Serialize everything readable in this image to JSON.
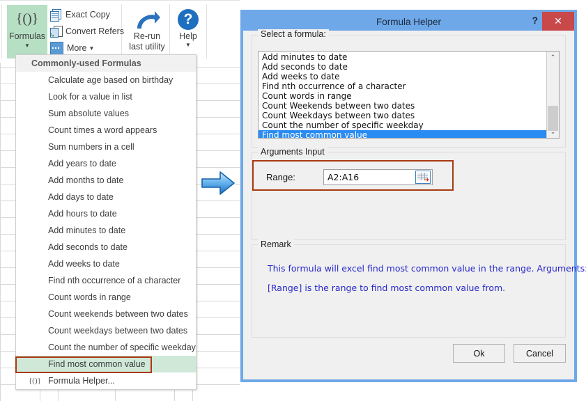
{
  "ribbon": {
    "formulas_button": {
      "glyph": "{()}",
      "label": "Formulas",
      "caret": "▼"
    },
    "items": [
      {
        "label": "Exact Copy",
        "icon": "copy-icon",
        "has_dropdown": false
      },
      {
        "label": "Convert Refers",
        "icon": "convert-refs-icon",
        "has_dropdown": false
      },
      {
        "label": "More",
        "icon": "more-icon",
        "has_dropdown": true,
        "dropdown": "▼"
      }
    ],
    "rerun_button": {
      "line1": "Re-run",
      "line2": "last utility",
      "icon": "redo-arrow-icon"
    },
    "help_button": {
      "label": "Help",
      "glyph": "?",
      "caret": "▼"
    }
  },
  "menu": {
    "header": "Commonly-used Formulas",
    "items": [
      {
        "label": "Calculate age based on birthday"
      },
      {
        "label": "Look for a value in list"
      },
      {
        "label": "Sum absolute values"
      },
      {
        "label": "Count times a word appears"
      },
      {
        "label": "Sum numbers in a cell"
      },
      {
        "label": "Add years to date"
      },
      {
        "label": "Add months to date"
      },
      {
        "label": "Add days to date"
      },
      {
        "label": "Add hours to date"
      },
      {
        "label": "Add minutes to date"
      },
      {
        "label": "Add seconds to date"
      },
      {
        "label": "Add weeks to date"
      },
      {
        "label": "Find nth occurrence of a character"
      },
      {
        "label": "Count words in range"
      },
      {
        "label": "Count weekends between two dates"
      },
      {
        "label": "Count weekdays between two dates"
      },
      {
        "label": "Count the number of specific weekday"
      },
      {
        "label": "Find most common value",
        "selected": true
      },
      {
        "label": "Formula Helper...",
        "glyph": "{()}"
      }
    ]
  },
  "arrow": {
    "name": "blue-right-arrow"
  },
  "dialog": {
    "title": "Formula Helper",
    "help_glyph": "?",
    "close_glyph": "✕",
    "select_panel": {
      "legend": "Select a formula:",
      "items": [
        "Add minutes to date",
        "Add seconds to date",
        "Add weeks to date",
        "Find nth occurrence of a character",
        "Count words in range",
        "Count Weekends between two dates",
        "Count Weekdays between two dates",
        "Count the number of specific weekday",
        "Find most common value"
      ],
      "selected_index": 8,
      "scroll_up_glyph": "⌃",
      "scroll_down_glyph": "⌄"
    },
    "args_panel": {
      "legend": "Arguments Input",
      "range_label": "Range:",
      "range_value": "A2:A16",
      "range_placeholder": "",
      "picker_icon": "range-picker-icon"
    },
    "remark_panel": {
      "legend": "Remark",
      "line1": "This formula will excel find most common value in the range. Arguments:",
      "line2": "[Range] is the range to find most common value from."
    },
    "footer": {
      "ok_label": "Ok",
      "cancel_label": "Cancel"
    }
  },
  "colors": {
    "dialog_border": "#6fa8e8",
    "close_red": "#c9484a",
    "list_selection": "#2a8bf2",
    "menu_selection": "#cfe8d8",
    "highlight_outline": "#a83a12",
    "ribbon_active": "#b6dfc3",
    "remark_text": "#2828cc"
  }
}
